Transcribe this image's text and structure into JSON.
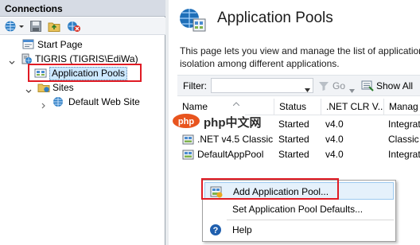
{
  "connections": {
    "header": "Connections",
    "tree": {
      "start_page": "Start Page",
      "server": "TIGRIS (TIGRIS\\EdiWa)",
      "app_pools": "Application Pools",
      "sites": "Sites",
      "default_site": "Default Web Site"
    }
  },
  "main": {
    "title": "Application Pools",
    "description_line1": "This page lets you view and manage the list of application",
    "description_line2": "isolation among different applications.",
    "filter": {
      "label": "Filter:",
      "value": "",
      "go_label": "Go",
      "show_all_label": "Show All"
    },
    "columns": [
      "Name",
      "Status",
      ".NET CLR V...",
      "Manag"
    ],
    "rows": [
      {
        "name": ".NET v4.5",
        "status": "Started",
        "clr": "v4.0",
        "pipeline": "Integrat"
      },
      {
        "name": ".NET v4.5 Classic",
        "status": "Started",
        "clr": "v4.0",
        "pipeline": "Classic"
      },
      {
        "name": "DefaultAppPool",
        "status": "Started",
        "clr": "v4.0",
        "pipeline": "Integrat"
      }
    ]
  },
  "context_menu": {
    "items": [
      "Add Application Pool...",
      "Set Application Pool Defaults...",
      "Help"
    ]
  },
  "watermark": {
    "text": "php中文网"
  },
  "colors": {
    "highlight_red": "#e01b24",
    "selection_blue": "#cce8ff",
    "header_bg": "#d6dbe4",
    "watermark_orange": "#e8541e"
  }
}
